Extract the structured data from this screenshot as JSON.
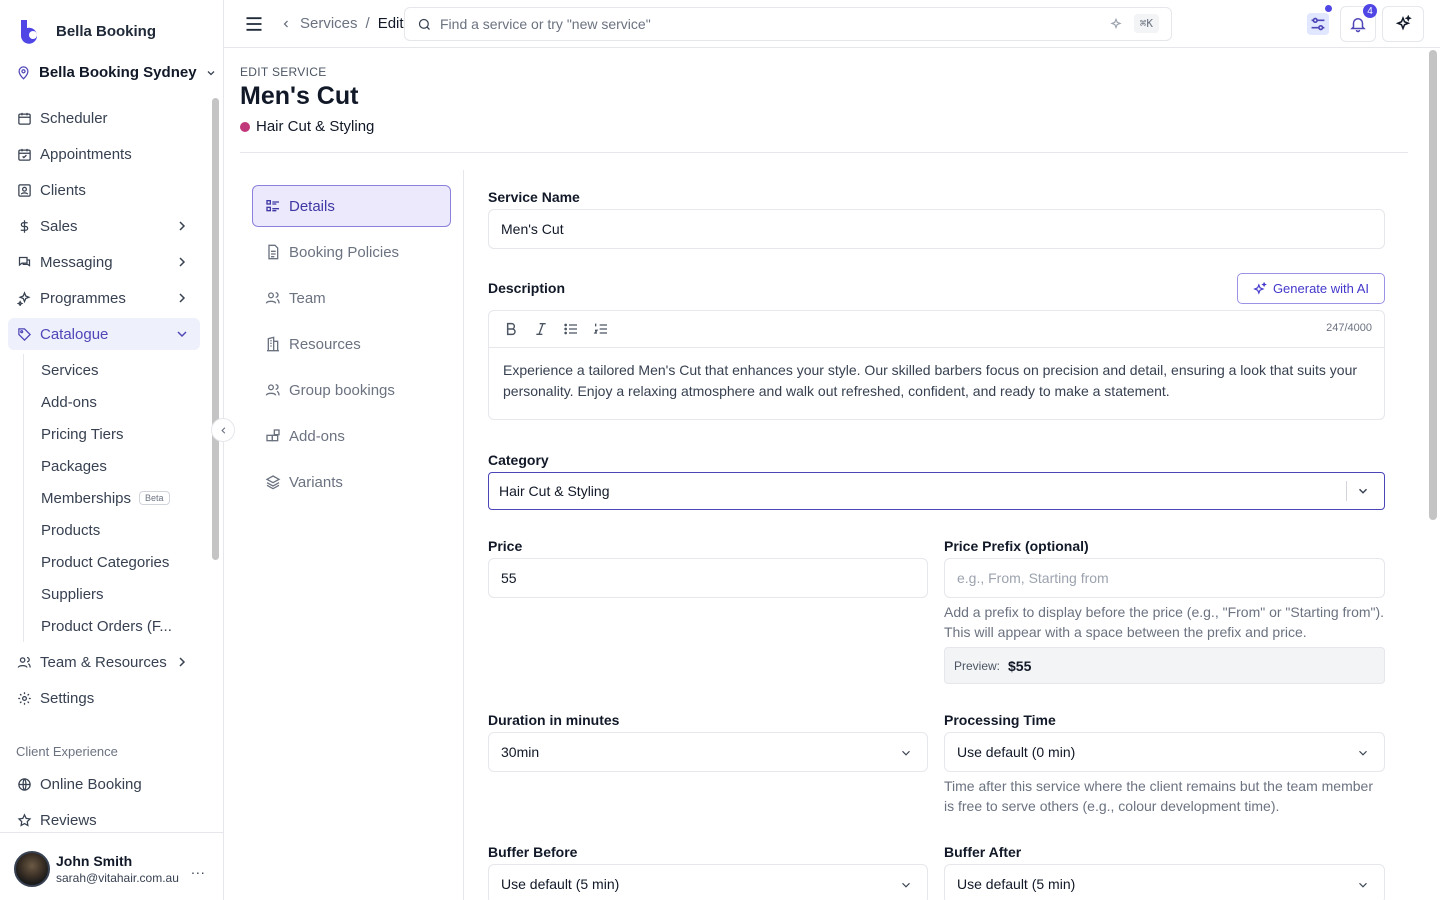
{
  "brand": {
    "name": "Bella Booking",
    "accent": "#4f46b8"
  },
  "location": {
    "name": "Bella Booking Sydney"
  },
  "sidebar": {
    "items": [
      {
        "label": "Scheduler",
        "icon": "calendar-icon"
      },
      {
        "label": "Appointments",
        "icon": "calendar-check-icon"
      },
      {
        "label": "Clients",
        "icon": "contact-icon"
      },
      {
        "label": "Sales",
        "icon": "dollar-icon"
      },
      {
        "label": "Messaging",
        "icon": "chat-icon"
      },
      {
        "label": "Programmes",
        "icon": "sparkles-icon"
      },
      {
        "label": "Catalogue",
        "icon": "tag-icon"
      }
    ],
    "catalogue_sub": [
      "Services",
      "Add-ons",
      "Pricing Tiers",
      "Packages",
      "Memberships",
      "Products",
      "Product Categories",
      "Suppliers",
      "Product Orders (F..."
    ],
    "beta_badge": "Beta",
    "team_resources": "Team & Resources",
    "settings": "Settings",
    "section_label": "Client Experience",
    "client_items": [
      "Online Booking",
      "Reviews"
    ]
  },
  "user": {
    "name": "John Smith",
    "email": "sarah@vitahair.com.au",
    "more": "..."
  },
  "topbar": {
    "breadcrumb_parent": "Services",
    "breadcrumb_sep": "/",
    "breadcrumb_current": "Edit",
    "search_placeholder": "Find a service or try \"new service\"",
    "shortcut": "⌘K",
    "notification_count": "4"
  },
  "header": {
    "eyebrow": "EDIT SERVICE",
    "title": "Men's Cut",
    "category": "Hair Cut & Styling",
    "category_color": "#c0377a"
  },
  "tabs": [
    {
      "label": "Details",
      "icon": "list-icon"
    },
    {
      "label": "Booking Policies",
      "icon": "document-icon"
    },
    {
      "label": "Team",
      "icon": "users-icon"
    },
    {
      "label": "Resources",
      "icon": "building-icon"
    },
    {
      "label": "Group bookings",
      "icon": "group-icon"
    },
    {
      "label": "Add-ons",
      "icon": "blocks-icon"
    },
    {
      "label": "Variants",
      "icon": "layers-icon"
    }
  ],
  "form": {
    "service_name_label": "Service Name",
    "service_name_value": "Men's Cut",
    "description_label": "Description",
    "generate_ai": "Generate with AI",
    "char_count": "247/4000",
    "description_text": "Experience a tailored Men's Cut that enhances your style. Our skilled barbers focus on precision and detail, ensuring a look that suits your personality. Enjoy a relaxing atmosphere and walk out refreshed, confident, and ready to make a statement.",
    "category_label": "Category",
    "category_value": "Hair Cut & Styling",
    "price_label": "Price",
    "price_value": "55",
    "price_prefix_label": "Price Prefix (optional)",
    "price_prefix_placeholder": "e.g., From, Starting from",
    "price_prefix_help": "Add a prefix to display before the price (e.g., \"From\" or \"Starting from\"). This will appear with a space between the prefix and price.",
    "preview_label": "Preview:",
    "preview_value": "$55",
    "duration_label": "Duration in minutes",
    "duration_value": "30min",
    "processing_label": "Processing Time",
    "processing_value": "Use default (0 min)",
    "processing_help": "Time after this service where the client remains but the team member is free to serve others (e.g., colour development time).",
    "buffer_before_label": "Buffer Before",
    "buffer_before_value": "Use default (5 min)",
    "buffer_after_label": "Buffer After",
    "buffer_after_value": "Use default (5 min)"
  }
}
